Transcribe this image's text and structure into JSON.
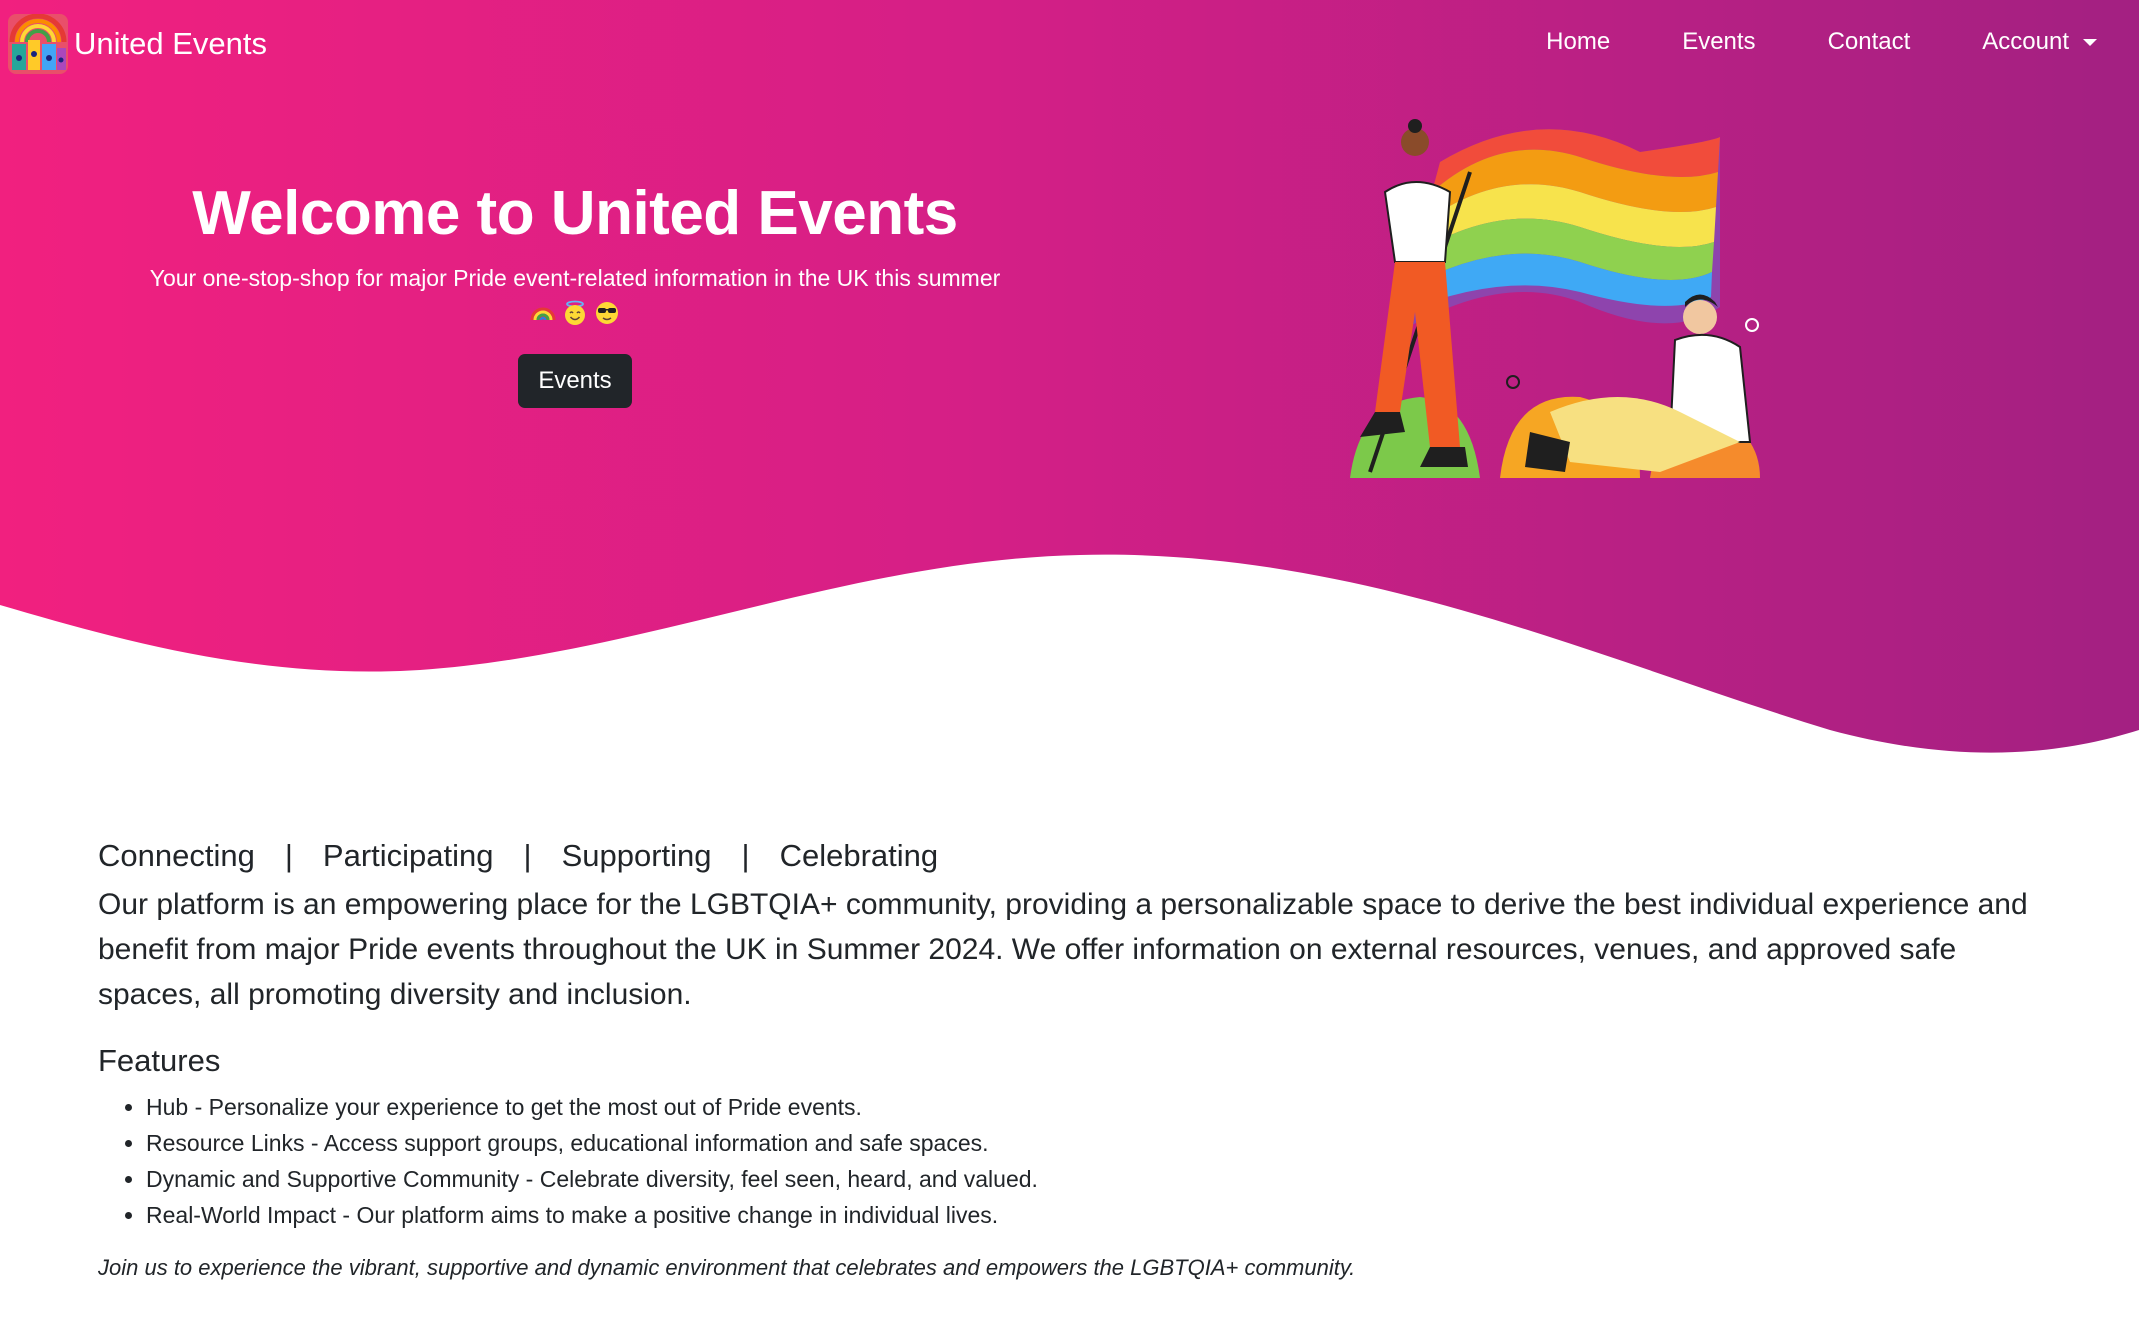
{
  "brand": {
    "name": "United Events"
  },
  "nav": {
    "home": "Home",
    "events": "Events",
    "contact": "Contact",
    "account": "Account"
  },
  "hero": {
    "title": "Welcome to United Events",
    "subtitle": "Your one-stop-shop for major Pride event-related information in the UK this summer",
    "emojis": [
      "rainbow",
      "smiling-face-with-halo",
      "smiling-face-with-sunglasses"
    ],
    "button_label": "Events"
  },
  "pillars": [
    "Connecting",
    "Participating",
    "Supporting",
    "Celebrating"
  ],
  "pillar_separator": "|",
  "intro": "Our platform is an empowering place for the LGBTQIA+ community, providing a personalizable space to derive the best individual experience and benefit from major Pride events throughout the UK in Summer 2024. We offer information on external resources, venues, and approved safe spaces, all promoting diversity and inclusion.",
  "features": {
    "title": "Features",
    "items": [
      "Hub - Personalize your experience to get the most out of Pride events.",
      "Resource Links - Access support groups, educational information and safe spaces.",
      "Dynamic and Supportive Community - Celebrate diversity, feel seen, heard, and valued.",
      "Real-World Impact - Our platform aims to make a positive change in individual lives."
    ]
  },
  "closing": "Join us to experience the vibrant, supportive and dynamic environment that celebrates and empowers the LGBTQIA+ community.",
  "colors": {
    "hero_gradient_start": "#f1207f",
    "hero_gradient_end": "#a32082",
    "button_bg": "#212529",
    "text": "#212529"
  }
}
